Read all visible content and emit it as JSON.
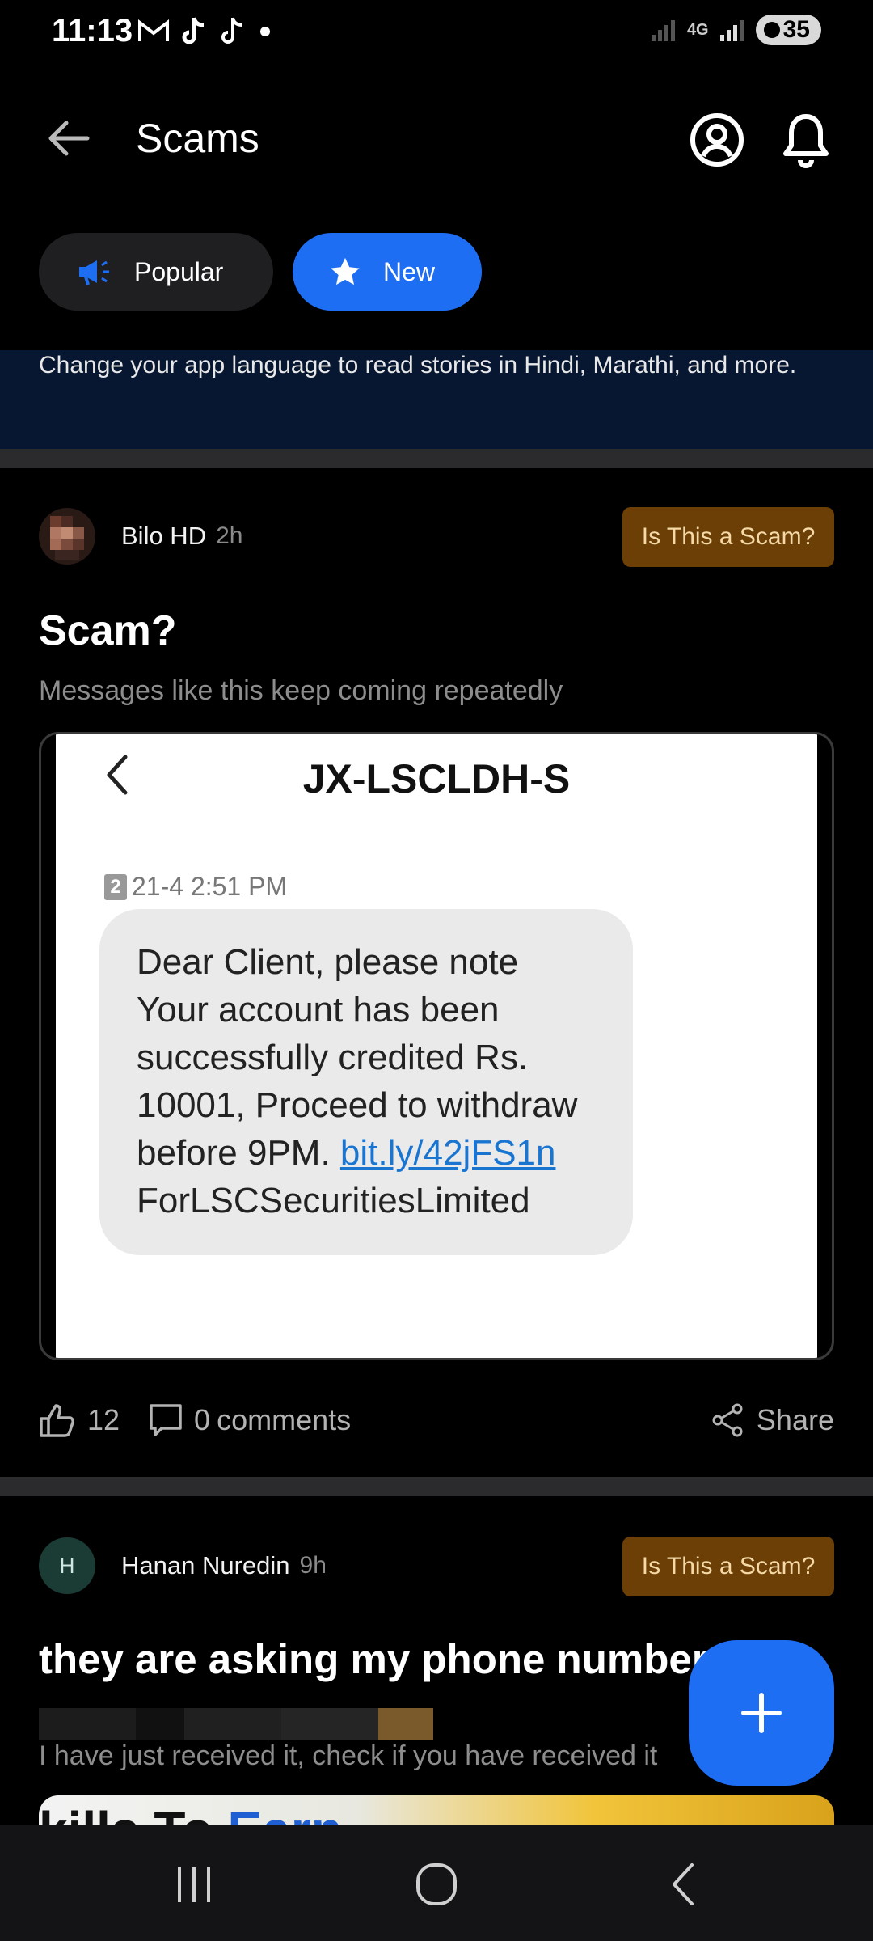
{
  "status_bar": {
    "time": "11:13",
    "network": "4G",
    "battery": "35"
  },
  "header": {
    "title": "Scams"
  },
  "tabs": [
    {
      "label": "Popular",
      "icon": "megaphone-icon"
    },
    {
      "label": "New",
      "icon": "star-icon"
    }
  ],
  "banner": {
    "text": "Change your app language to read stories in Hindi, Marathi, and more."
  },
  "posts": [
    {
      "author": "Bilo HD",
      "time": "2h",
      "tag_button": "Is This a Scam?",
      "title": "Scam?",
      "description": "Messages like this keep coming repeatedly",
      "image": {
        "sender": "JX-LSCLDH-S",
        "sim": "2",
        "date": "21-4 2:51 PM",
        "message_before_link": "Dear Client, please note Your account has been successfully credited Rs. 10001, Proceed to withdraw before 9PM. ",
        "link": "bit.ly/42jFS1n",
        "message_after_link": " ForLSCSecuritiesLimited"
      },
      "likes": "12",
      "comments_count": "0",
      "comments_label": "comments",
      "share_label": "Share"
    },
    {
      "author": "Hanan Nuredin",
      "avatar_letter": "H",
      "time": "9h",
      "tag_button": "Is This a Scam?",
      "title": "they are asking my phone number",
      "description": "I have just received it, check if you have received it",
      "image_text_a": "kills To ",
      "image_text_b": "Earn"
    }
  ],
  "colors": {
    "accent": "#1e6ef4",
    "scam_button": "#6b3f05",
    "banner": "#071731"
  }
}
